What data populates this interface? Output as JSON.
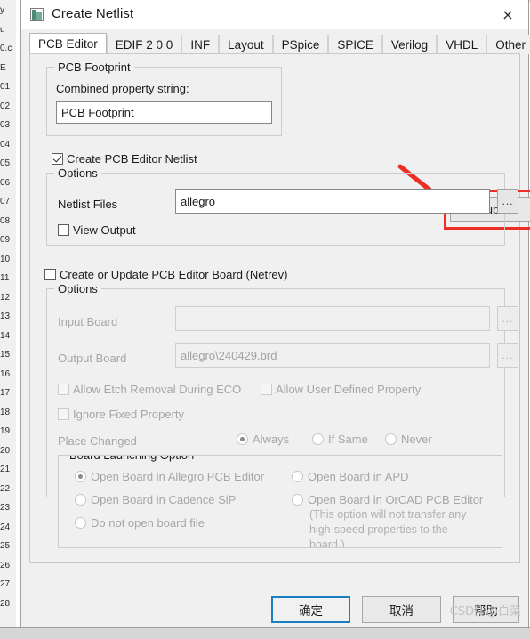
{
  "window": {
    "title": "Create Netlist",
    "icon": "app-icon",
    "close_label": "×"
  },
  "tabs": [
    {
      "label": "PCB Editor",
      "active": true
    },
    {
      "label": "EDIF 2 0 0",
      "active": false
    },
    {
      "label": "INF",
      "active": false
    },
    {
      "label": "Layout",
      "active": false
    },
    {
      "label": "PSpice",
      "active": false
    },
    {
      "label": "SPICE",
      "active": false
    },
    {
      "label": "Verilog",
      "active": false
    },
    {
      "label": "VHDL",
      "active": false
    },
    {
      "label": "Other",
      "active": false
    }
  ],
  "pcb_footprint": {
    "group_title": "PCB Footprint",
    "combined_label": "Combined property string:",
    "combined_value": "PCB Footprint"
  },
  "create_netlist_checkbox": {
    "label": "Create PCB Editor Netlist",
    "checked": true
  },
  "setup_button": {
    "label": "Setup ..."
  },
  "options_netlist": {
    "group_title": "Options",
    "netlist_files_label": "Netlist Files",
    "netlist_files_value": "allegro",
    "browse_label": "...",
    "view_output_label": "View Output",
    "view_output_checked": false
  },
  "netrev_checkbox": {
    "label": "Create or Update PCB Editor Board (Netrev)",
    "checked": false
  },
  "options_board": {
    "group_title": "Options",
    "input_board_label": "Input Board",
    "input_board_value": "",
    "input_browse_label": "...",
    "output_board_label": "Output Board",
    "output_board_value": "allegro\\240429.brd",
    "output_browse_label": "...",
    "allow_etch_label": "Allow Etch Removal During ECO",
    "allow_etch_checked": false,
    "allow_user_prop_label": "Allow User Defined Property",
    "allow_user_prop_checked": false,
    "ignore_fixed_label": "Ignore Fixed Property",
    "ignore_fixed_checked": false,
    "place_changed_label": "Place Changed",
    "place_changed_options": [
      {
        "label": "Always",
        "selected": true
      },
      {
        "label": "If Same",
        "selected": false
      },
      {
        "label": "Never",
        "selected": false
      }
    ]
  },
  "board_launching": {
    "group_title": "Board Launching Option",
    "options": [
      {
        "label": "Open Board in Allegro PCB Editor",
        "selected": true
      },
      {
        "label": "Open Board in Cadence SiP",
        "selected": false
      },
      {
        "label": "Do not open board file",
        "selected": false
      },
      {
        "label": "Open Board in APD",
        "selected": false
      },
      {
        "label": "Open Board in OrCAD PCB Editor",
        "selected": false
      }
    ],
    "note_lines": [
      "(This option will not transfer any",
      "high-speed properties to the",
      "board.)"
    ]
  },
  "footer": {
    "ok_label": "确定",
    "cancel_label": "取消",
    "help_label": "帮助"
  },
  "annotation": {
    "highlight_color": "#ee2e24",
    "arrow_color": "#ee2e24"
  },
  "watermark": {
    "text": "CSDN @白菜"
  },
  "background": {
    "row_numbers": [
      "y",
      "u",
      "0.c",
      "E",
      "01",
      "02",
      "03",
      "04",
      "05",
      "06",
      "07",
      "08",
      "09",
      "10",
      "11",
      "12",
      "13",
      "14",
      "15",
      "16",
      "17",
      "18",
      "19",
      "20",
      "21",
      "22",
      "23",
      "24",
      "25",
      "26",
      "27",
      "28"
    ]
  }
}
